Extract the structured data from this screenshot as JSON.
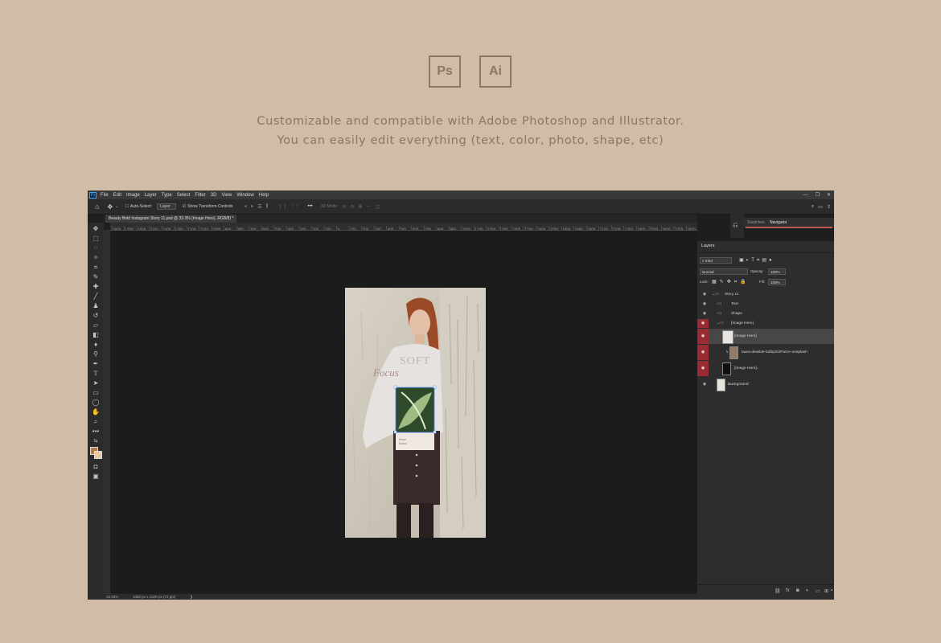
{
  "badges": [
    {
      "label": "Ps"
    },
    {
      "label": "Ai"
    }
  ],
  "tagline": {
    "line1": "Customizable and compatible with Adobe Photoshop and Illustrator.",
    "line2": "You can easily edit everything (text, color, photo, shape, etc)"
  },
  "app": {
    "logo": "Ps",
    "menu": [
      "File",
      "Edit",
      "Image",
      "Layer",
      "Type",
      "Select",
      "Filter",
      "3D",
      "View",
      "Window",
      "Help"
    ],
    "window_controls": [
      "—",
      "❐",
      "✕"
    ],
    "options": {
      "auto_select": "Auto-Select:",
      "layer_select": "Layer",
      "show_transform": "Show Transform Controls",
      "mode_3d": "3D Mode:"
    },
    "tab_title": "Beauty Bold Instagram Story 11.psd @ 33.3% (Image Here), RGB/8) *",
    "ruler_labels": [
      "1800",
      "1700",
      "1600",
      "1500",
      "1400",
      "1300",
      "1200",
      "1100",
      "1000",
      "900",
      "800",
      "700",
      "600",
      "500",
      "400",
      "300",
      "200",
      "100",
      "0",
      "100",
      "200",
      "300",
      "400",
      "500",
      "600",
      "700",
      "800",
      "900",
      "1000",
      "1100",
      "1200",
      "1300",
      "1400",
      "1500",
      "1600",
      "1700",
      "1800",
      "1900",
      "2000",
      "2100",
      "2200",
      "2300",
      "2400",
      "2500",
      "2600",
      "2700",
      "2800"
    ],
    "status": {
      "zoom": "33.33%",
      "doc_size": "1080 px x 1920 px (72 ppi)",
      "arrow": "❯"
    },
    "canvas_text": {
      "word1": "SOFT",
      "word2": "Focus",
      "card_small_1": "Small",
      "card_small_2": "Button"
    }
  },
  "panels": {
    "tabs": [
      "Swatches",
      "Navigator"
    ],
    "layers": {
      "title": "Layers",
      "filter_kind": "Kind",
      "blend_mode": "Normal",
      "opacity_label": "Opacity:",
      "opacity_value": "100%",
      "lock_label": "Lock:",
      "fill_label": "Fill:",
      "fill_value": "100%",
      "rows": [
        {
          "name": "Story 11",
          "type": "group",
          "highlight": false
        },
        {
          "name": "Text",
          "type": "group",
          "highlight": false
        },
        {
          "name": "Shape",
          "type": "group",
          "highlight": false
        },
        {
          "name": "[Image Here]",
          "type": "group",
          "highlight": true
        },
        {
          "name": "[Image Here]",
          "type": "layer",
          "highlight": true
        },
        {
          "name": "laura-dewilde-bdibpSSPaOA-unsplash",
          "type": "layer",
          "highlight": true
        },
        {
          "name": "[Image Here]...",
          "type": "layer",
          "highlight": true
        },
        {
          "name": "Background",
          "type": "layer",
          "highlight": false
        }
      ]
    },
    "footer_icons": [
      "link-icon",
      "fx-icon",
      "mask-icon",
      "adjustment-icon",
      "folder-icon",
      "new-layer-icon",
      "trash-icon"
    ]
  },
  "colors": {
    "page_bg": "#d0bca7",
    "accent_text": "#8a7865",
    "layer_highlight": "#9a2b33",
    "foreground_swatch": "#b77a43",
    "background_swatch": "#e7c8a4"
  }
}
